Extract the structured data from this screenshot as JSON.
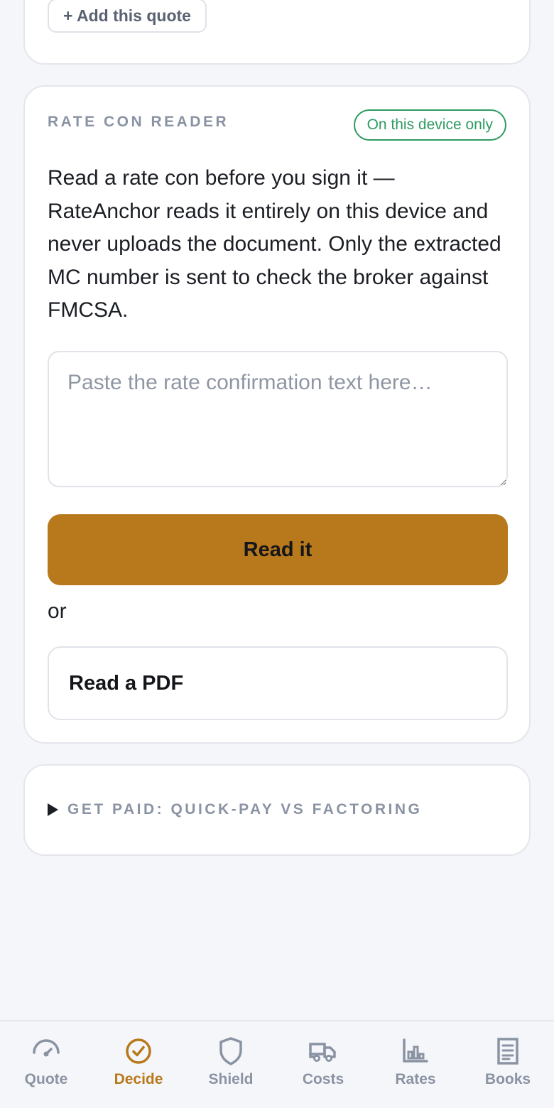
{
  "previous_card": {
    "add_quote_label": "+ Add this quote"
  },
  "rate_con_reader": {
    "section_label": "RATE CON READER",
    "device_badge": "On this device only",
    "description": "Read a rate con before you sign it — RateAnchor reads it entirely on this device and never uploads the document. Only the extracted MC number is sent to check the broker against FMCSA.",
    "textarea": {
      "value": "",
      "placeholder": "Paste the rate confirmation text here…"
    },
    "read_button_label": "Read it",
    "or_label": "or",
    "pdf_button_label": "Read a PDF"
  },
  "get_paid": {
    "summary_label": "GET PAID: QUICK-PAY VS FACTORING",
    "expanded": false
  },
  "bottom_nav": {
    "active": "Decide",
    "items": [
      {
        "label": "Quote",
        "icon": "gauge-icon"
      },
      {
        "label": "Decide",
        "icon": "check-circle-icon"
      },
      {
        "label": "Shield",
        "icon": "shield-icon"
      },
      {
        "label": "Costs",
        "icon": "truck-icon"
      },
      {
        "label": "Rates",
        "icon": "bar-chart-icon"
      },
      {
        "label": "Books",
        "icon": "document-icon"
      }
    ]
  },
  "colors": {
    "accent": "#b8781c",
    "badge_green": "#2f9a62",
    "muted": "#8a93a3",
    "background": "#f5f6f9"
  }
}
